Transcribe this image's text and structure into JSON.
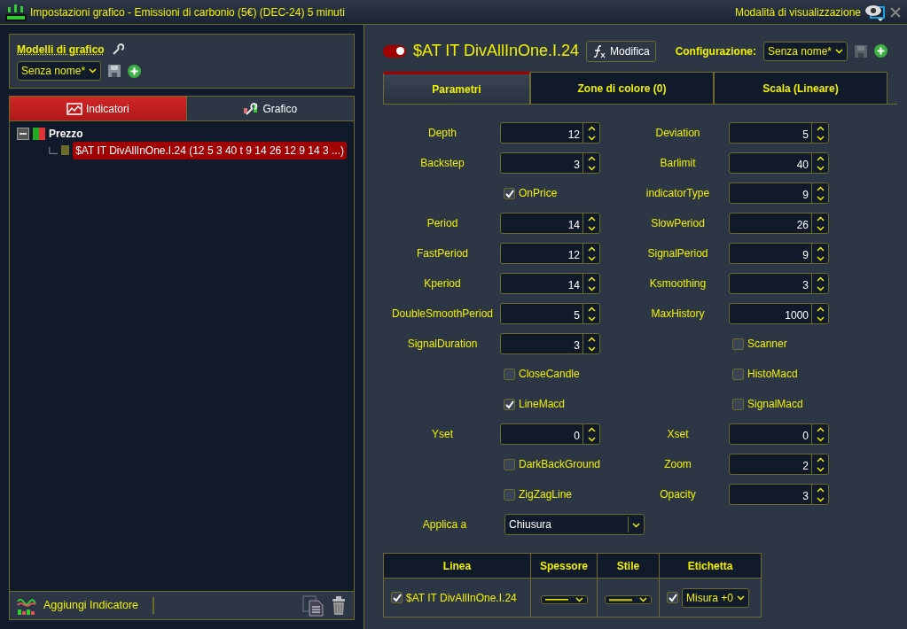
{
  "window": {
    "title": "Impostazioni grafico - Emissioni di carbonio (5€) (DEC-24) 5 minuti",
    "view_mode": "Modalità di visualizzazione"
  },
  "templates": {
    "label": "Modelli di grafico",
    "value": "Senza nome*"
  },
  "left_tabs": [
    {
      "label": "Indicatori",
      "selected": true
    },
    {
      "label": "Grafico",
      "selected": false
    }
  ],
  "tree": [
    {
      "label": "Prezzo",
      "expanded": true,
      "selected": false,
      "children": [
        {
          "label": "$AT IT DivAllInOne.I.24 (12 5 3 40 t 9 14 26 12 9 14 3 ...)",
          "selected": true,
          "color": "#6b6b2a"
        }
      ]
    }
  ],
  "footer": {
    "add_label": "Aggiungi Indicatore"
  },
  "indicator": {
    "on": true,
    "name": "$AT IT DivAllInOne.I.24",
    "edit_label": "Modifica",
    "config_label": "Configurazione:",
    "config_value": "Senza nome*"
  },
  "right_tabs": [
    {
      "label": "Parametri",
      "selected": true
    },
    {
      "label": "Zone di colore (0)",
      "selected": false
    },
    {
      "label": "Scala (Lineare)",
      "selected": false
    }
  ],
  "parameters": [
    {
      "kind": "number",
      "label": "Depth",
      "value": "12"
    },
    {
      "kind": "number",
      "label": "Deviation",
      "value": "5"
    },
    {
      "kind": "number",
      "label": "Backstep",
      "value": "3"
    },
    {
      "kind": "number",
      "label": "Barlimit",
      "value": "40"
    },
    {
      "kind": "checkbox",
      "label": "OnPrice",
      "checked": true
    },
    {
      "kind": "number",
      "label": "indicatorType",
      "value": "9"
    },
    {
      "kind": "number",
      "label": "Period",
      "value": "14"
    },
    {
      "kind": "number",
      "label": "SlowPeriod",
      "value": "26"
    },
    {
      "kind": "number",
      "label": "FastPeriod",
      "value": "12"
    },
    {
      "kind": "number",
      "label": "SignalPeriod",
      "value": "9"
    },
    {
      "kind": "number",
      "label": "Kperiod",
      "value": "14"
    },
    {
      "kind": "number",
      "label": "Ksmoothing",
      "value": "3"
    },
    {
      "kind": "number",
      "label": "DoubleSmoothPeriod",
      "value": "5"
    },
    {
      "kind": "number",
      "label": "MaxHistory",
      "value": "1000"
    },
    {
      "kind": "number",
      "label": "SignalDuration",
      "value": "3"
    },
    {
      "kind": "checkbox",
      "label": "Scanner",
      "checked": false
    },
    {
      "kind": "checkbox",
      "label": "CloseCandle",
      "checked": false
    },
    {
      "kind": "checkbox",
      "label": "HistoMacd",
      "checked": false
    },
    {
      "kind": "checkbox",
      "label": "LineMacd",
      "checked": true
    },
    {
      "kind": "checkbox",
      "label": "SignalMacd",
      "checked": false
    },
    {
      "kind": "number",
      "label": "Yset",
      "value": "0"
    },
    {
      "kind": "number",
      "label": "Xset",
      "value": "0"
    },
    {
      "kind": "checkbox",
      "label": "DarkBackGround",
      "checked": false
    },
    {
      "kind": "number",
      "label": "Zoom",
      "value": "2"
    },
    {
      "kind": "checkbox",
      "label": "ZigZagLine",
      "checked": false
    },
    {
      "kind": "number",
      "label": "Opacity",
      "value": "3"
    }
  ],
  "apply_to": {
    "label": "Applica a",
    "value": "Chiusura"
  },
  "table": {
    "columns": [
      "Linea",
      "Spessore",
      "Stile",
      "Etichetta"
    ],
    "rows": [
      {
        "checked": true,
        "line": "$AT IT DivAllInOne.I.24",
        "label_checked": true,
        "label_value": "Misura +0"
      }
    ]
  }
}
